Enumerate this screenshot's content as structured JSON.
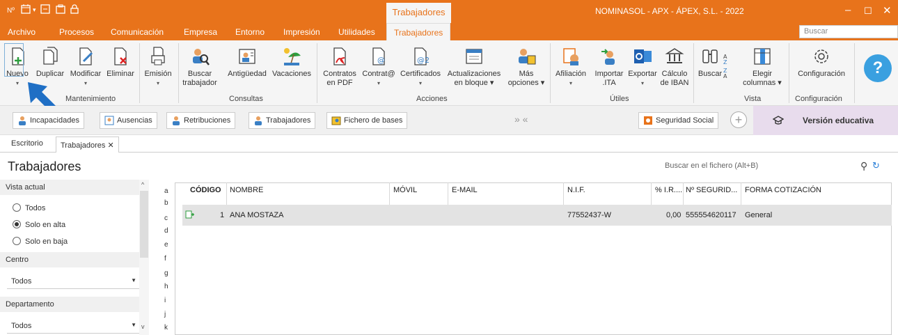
{
  "titlebar": {
    "context_tab": "Trabajadores",
    "window_title": "NOMINASOL - APX - ÁPEX, S.L. - 2022",
    "quick_icons": [
      "Nº",
      "▦",
      "⎘",
      "⌂",
      "🔒"
    ]
  },
  "tabs": [
    "Archivo",
    "Procesos",
    "Comunicación",
    "Empresa",
    "Entorno",
    "Impresión",
    "Utilidades",
    "Trabajadores"
  ],
  "active_tab": "Trabajadores",
  "search_placeholder": "Buscar",
  "ribbon": {
    "mantenimiento": {
      "label": "Mantenimiento",
      "buttons": [
        "Nuevo",
        "Duplicar",
        "Modificar",
        "Eliminar",
        "Emisión"
      ]
    },
    "consultas": {
      "label": "Consultas",
      "buttons": [
        "Buscar trabajador",
        "Antigüedad",
        "Vacaciones"
      ],
      "buscar_line1": "Buscar",
      "buscar_line2": "trabajador"
    },
    "acciones": {
      "label": "Acciones",
      "contratos_line1": "Contratos",
      "contratos_line2": "en PDF",
      "contrat": "Contrat@",
      "certificados": "Certificados",
      "act_line1": "Actualizaciones",
      "act_line2": "en bloque ▾",
      "mas_line1": "Más",
      "mas_line2": "opciones ▾"
    },
    "utiles": {
      "label": "Útiles",
      "afiliacion": "Afiliación",
      "importar_line1": "Importar",
      "importar_line2": ".ITA",
      "exportar": "Exportar",
      "calculo_line1": "Cálculo",
      "calculo_line2": "de IBAN"
    },
    "vista": {
      "label": "Vista",
      "buscar": "Buscar",
      "elegir_line1": "Elegir",
      "elegir_line2": "columnas ▾"
    },
    "configuracion": {
      "label": "Configuración",
      "button": "Configuración"
    },
    "help": "?"
  },
  "quickbar": {
    "buttons": [
      "Incapacidades",
      "Ausencias",
      "Retribuciones",
      "Trabajadores",
      "Fichero de bases"
    ],
    "chevrons": "»  «",
    "seguridad": "Seguridad Social",
    "edu": "Versión educativa"
  },
  "doc_tabs": [
    "Escritorio",
    "Trabajadores ✕"
  ],
  "page_title": "Trabajadores",
  "file_search_placeholder": "Buscar en el fichero (Alt+B)",
  "left_panel": {
    "vista_actual": "Vista actual",
    "radios": [
      "Todos",
      "Solo en alta",
      "Solo en baja"
    ],
    "selected": "Solo en alta",
    "centro": "Centro",
    "centro_value": "Todos",
    "departamento": "Departamento",
    "departamento_value": "Todos"
  },
  "alphabet": [
    "a",
    "b",
    "c",
    "d",
    "e",
    "f",
    "g",
    "h",
    "i",
    "j",
    "k"
  ],
  "table": {
    "columns": [
      "CÓDIGO",
      "NOMBRE",
      "MÓVIL",
      "E-MAIL",
      "N.I.F.",
      "% I.R....",
      "Nº SEGURID...",
      "FORMA COTIZACIÓN"
    ],
    "rows": [
      {
        "codigo": "1",
        "nombre": "ANA MOSTAZA",
        "movil": "",
        "email": "",
        "nif": "77552437-W",
        "ir": "0,00",
        "seguridad": "555554620117",
        "forma": "General"
      }
    ]
  },
  "colors": {
    "accent": "#e8731b",
    "edu_bg": "#e8dced",
    "help": "#3aa0e0"
  }
}
